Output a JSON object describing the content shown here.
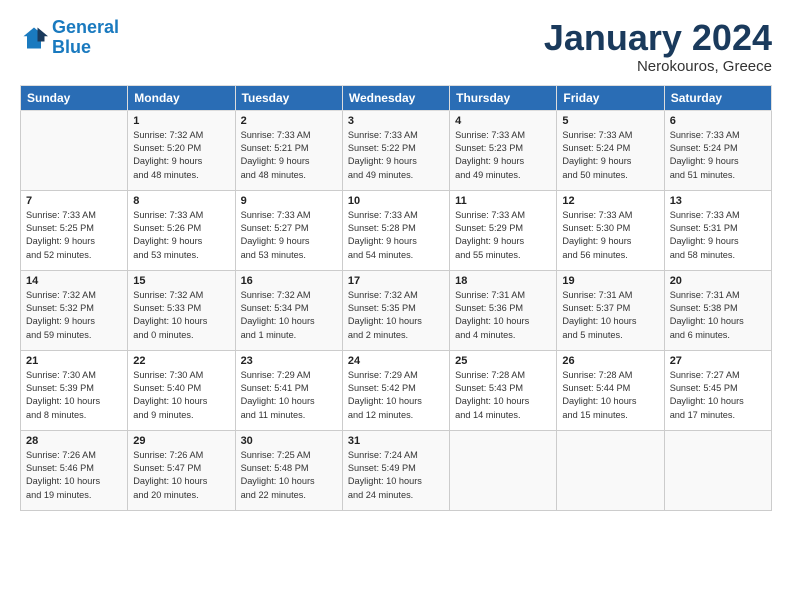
{
  "logo": {
    "line1": "General",
    "line2": "Blue"
  },
  "title": "January 2024",
  "subtitle": "Nerokouros, Greece",
  "header_days": [
    "Sunday",
    "Monday",
    "Tuesday",
    "Wednesday",
    "Thursday",
    "Friday",
    "Saturday"
  ],
  "weeks": [
    [
      {
        "num": "",
        "info": ""
      },
      {
        "num": "1",
        "info": "Sunrise: 7:32 AM\nSunset: 5:20 PM\nDaylight: 9 hours\nand 48 minutes."
      },
      {
        "num": "2",
        "info": "Sunrise: 7:33 AM\nSunset: 5:21 PM\nDaylight: 9 hours\nand 48 minutes."
      },
      {
        "num": "3",
        "info": "Sunrise: 7:33 AM\nSunset: 5:22 PM\nDaylight: 9 hours\nand 49 minutes."
      },
      {
        "num": "4",
        "info": "Sunrise: 7:33 AM\nSunset: 5:23 PM\nDaylight: 9 hours\nand 49 minutes."
      },
      {
        "num": "5",
        "info": "Sunrise: 7:33 AM\nSunset: 5:24 PM\nDaylight: 9 hours\nand 50 minutes."
      },
      {
        "num": "6",
        "info": "Sunrise: 7:33 AM\nSunset: 5:24 PM\nDaylight: 9 hours\nand 51 minutes."
      }
    ],
    [
      {
        "num": "7",
        "info": "Sunrise: 7:33 AM\nSunset: 5:25 PM\nDaylight: 9 hours\nand 52 minutes."
      },
      {
        "num": "8",
        "info": "Sunrise: 7:33 AM\nSunset: 5:26 PM\nDaylight: 9 hours\nand 53 minutes."
      },
      {
        "num": "9",
        "info": "Sunrise: 7:33 AM\nSunset: 5:27 PM\nDaylight: 9 hours\nand 53 minutes."
      },
      {
        "num": "10",
        "info": "Sunrise: 7:33 AM\nSunset: 5:28 PM\nDaylight: 9 hours\nand 54 minutes."
      },
      {
        "num": "11",
        "info": "Sunrise: 7:33 AM\nSunset: 5:29 PM\nDaylight: 9 hours\nand 55 minutes."
      },
      {
        "num": "12",
        "info": "Sunrise: 7:33 AM\nSunset: 5:30 PM\nDaylight: 9 hours\nand 56 minutes."
      },
      {
        "num": "13",
        "info": "Sunrise: 7:33 AM\nSunset: 5:31 PM\nDaylight: 9 hours\nand 58 minutes."
      }
    ],
    [
      {
        "num": "14",
        "info": "Sunrise: 7:32 AM\nSunset: 5:32 PM\nDaylight: 9 hours\nand 59 minutes."
      },
      {
        "num": "15",
        "info": "Sunrise: 7:32 AM\nSunset: 5:33 PM\nDaylight: 10 hours\nand 0 minutes."
      },
      {
        "num": "16",
        "info": "Sunrise: 7:32 AM\nSunset: 5:34 PM\nDaylight: 10 hours\nand 1 minute."
      },
      {
        "num": "17",
        "info": "Sunrise: 7:32 AM\nSunset: 5:35 PM\nDaylight: 10 hours\nand 2 minutes."
      },
      {
        "num": "18",
        "info": "Sunrise: 7:31 AM\nSunset: 5:36 PM\nDaylight: 10 hours\nand 4 minutes."
      },
      {
        "num": "19",
        "info": "Sunrise: 7:31 AM\nSunset: 5:37 PM\nDaylight: 10 hours\nand 5 minutes."
      },
      {
        "num": "20",
        "info": "Sunrise: 7:31 AM\nSunset: 5:38 PM\nDaylight: 10 hours\nand 6 minutes."
      }
    ],
    [
      {
        "num": "21",
        "info": "Sunrise: 7:30 AM\nSunset: 5:39 PM\nDaylight: 10 hours\nand 8 minutes."
      },
      {
        "num": "22",
        "info": "Sunrise: 7:30 AM\nSunset: 5:40 PM\nDaylight: 10 hours\nand 9 minutes."
      },
      {
        "num": "23",
        "info": "Sunrise: 7:29 AM\nSunset: 5:41 PM\nDaylight: 10 hours\nand 11 minutes."
      },
      {
        "num": "24",
        "info": "Sunrise: 7:29 AM\nSunset: 5:42 PM\nDaylight: 10 hours\nand 12 minutes."
      },
      {
        "num": "25",
        "info": "Sunrise: 7:28 AM\nSunset: 5:43 PM\nDaylight: 10 hours\nand 14 minutes."
      },
      {
        "num": "26",
        "info": "Sunrise: 7:28 AM\nSunset: 5:44 PM\nDaylight: 10 hours\nand 15 minutes."
      },
      {
        "num": "27",
        "info": "Sunrise: 7:27 AM\nSunset: 5:45 PM\nDaylight: 10 hours\nand 17 minutes."
      }
    ],
    [
      {
        "num": "28",
        "info": "Sunrise: 7:26 AM\nSunset: 5:46 PM\nDaylight: 10 hours\nand 19 minutes."
      },
      {
        "num": "29",
        "info": "Sunrise: 7:26 AM\nSunset: 5:47 PM\nDaylight: 10 hours\nand 20 minutes."
      },
      {
        "num": "30",
        "info": "Sunrise: 7:25 AM\nSunset: 5:48 PM\nDaylight: 10 hours\nand 22 minutes."
      },
      {
        "num": "31",
        "info": "Sunrise: 7:24 AM\nSunset: 5:49 PM\nDaylight: 10 hours\nand 24 minutes."
      },
      {
        "num": "",
        "info": ""
      },
      {
        "num": "",
        "info": ""
      },
      {
        "num": "",
        "info": ""
      }
    ]
  ]
}
